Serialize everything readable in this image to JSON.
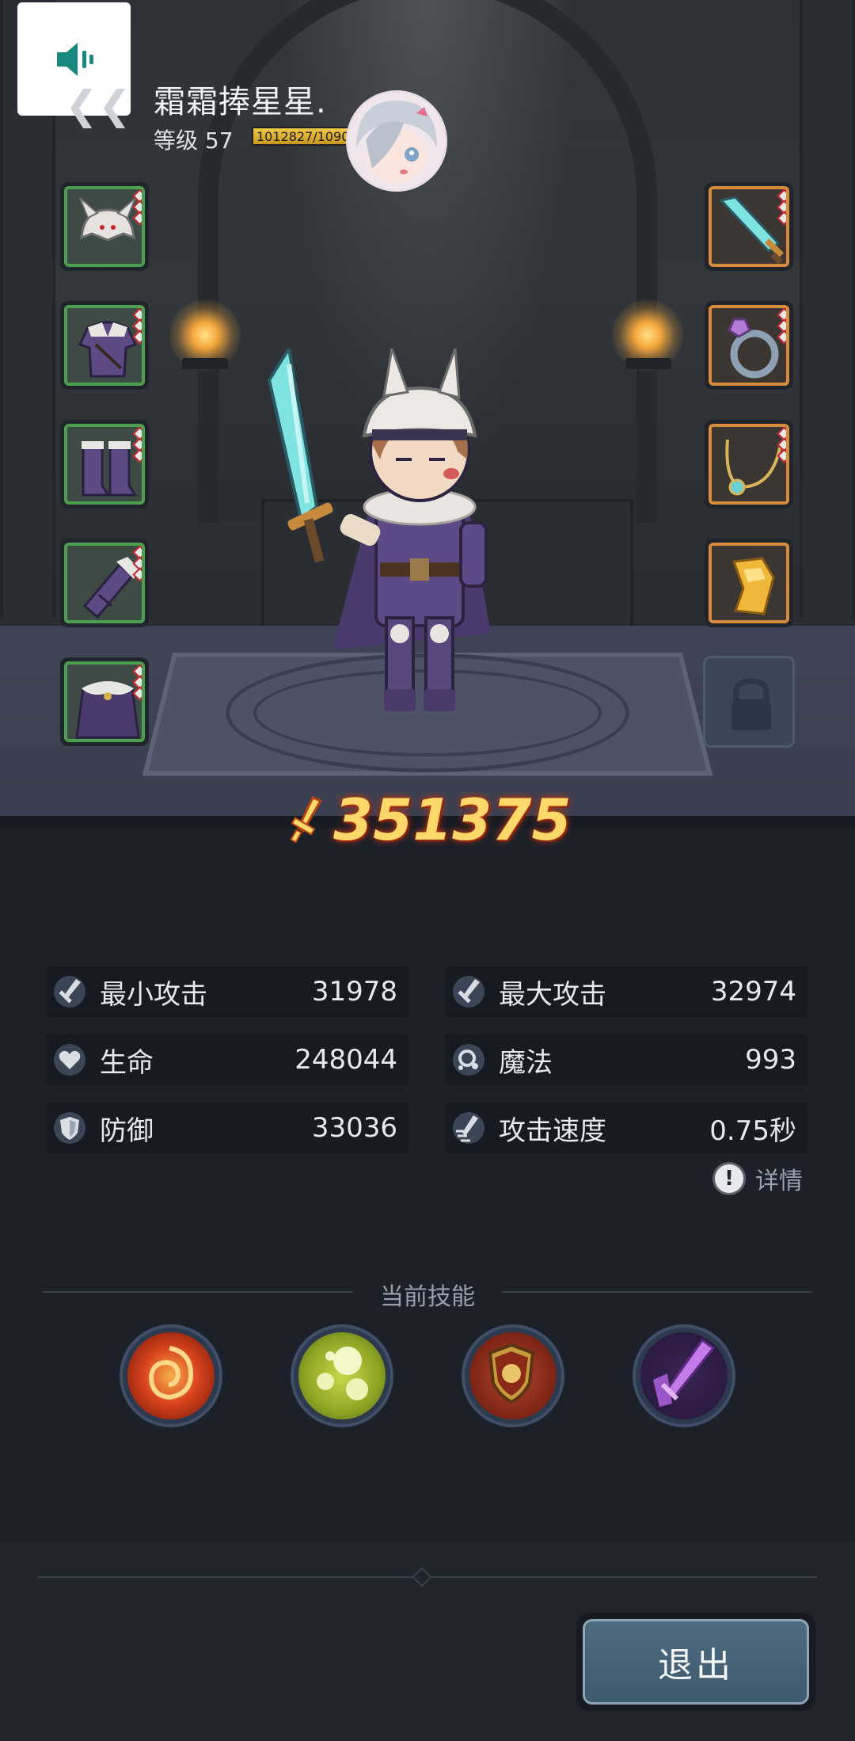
{
  "header": {
    "player_name": "霜霜捧星星.",
    "level_label": "等级 57",
    "exp_text": "1012827/1090",
    "exp_progress": 0.93,
    "sound_icon": "speaker-icon",
    "back_icon": "chevron-icon"
  },
  "equipment": {
    "left": [
      {
        "name": "helmet",
        "icon": "horned-helmet-icon",
        "rarity": "green"
      },
      {
        "name": "armor",
        "icon": "purple-coat-icon",
        "rarity": "green"
      },
      {
        "name": "boots",
        "icon": "purple-boots-icon",
        "rarity": "green"
      },
      {
        "name": "gloves",
        "icon": "bracer-icon",
        "rarity": "green"
      },
      {
        "name": "cape",
        "icon": "fur-cape-icon",
        "rarity": "green"
      }
    ],
    "right": [
      {
        "name": "weapon",
        "icon": "crystal-sword-icon",
        "rarity": "orange"
      },
      {
        "name": "ring",
        "icon": "gem-ring-icon",
        "rarity": "orange"
      },
      {
        "name": "necklace",
        "icon": "pendant-necklace-icon",
        "rarity": "orange"
      },
      {
        "name": "relic",
        "icon": "golden-relic-icon",
        "rarity": "orange"
      },
      {
        "name": "locked",
        "icon": "empty-slot-icon",
        "rarity": "empty"
      }
    ]
  },
  "power": {
    "value": "351375",
    "icon": "sword-power-icon"
  },
  "stats": [
    {
      "label": "最小攻击",
      "value": "31978",
      "icon": "sword-icon"
    },
    {
      "label": "最大攻击",
      "value": "32974",
      "icon": "sword-icon"
    },
    {
      "label": "生命",
      "value": "248044",
      "icon": "heart-icon"
    },
    {
      "label": "魔法",
      "value": "993",
      "icon": "magic-icon"
    },
    {
      "label": "防御",
      "value": "33036",
      "icon": "shield-icon"
    },
    {
      "label": "攻击速度",
      "value": "0.75秒",
      "icon": "speed-icon"
    }
  ],
  "detail": {
    "icon_text": "!",
    "label": "详情"
  },
  "skills": {
    "title": "当前技能",
    "items": [
      {
        "icon": "fire-vortex-icon"
      },
      {
        "icon": "poison-bubbles-icon"
      },
      {
        "icon": "guardian-shield-icon"
      },
      {
        "icon": "shadow-blade-icon"
      }
    ]
  },
  "footer": {
    "exit_label": "退出"
  },
  "colors": {
    "power": "#ffd86b",
    "green_rarity": "#4aa04f",
    "orange_rarity": "#d98a3a"
  }
}
